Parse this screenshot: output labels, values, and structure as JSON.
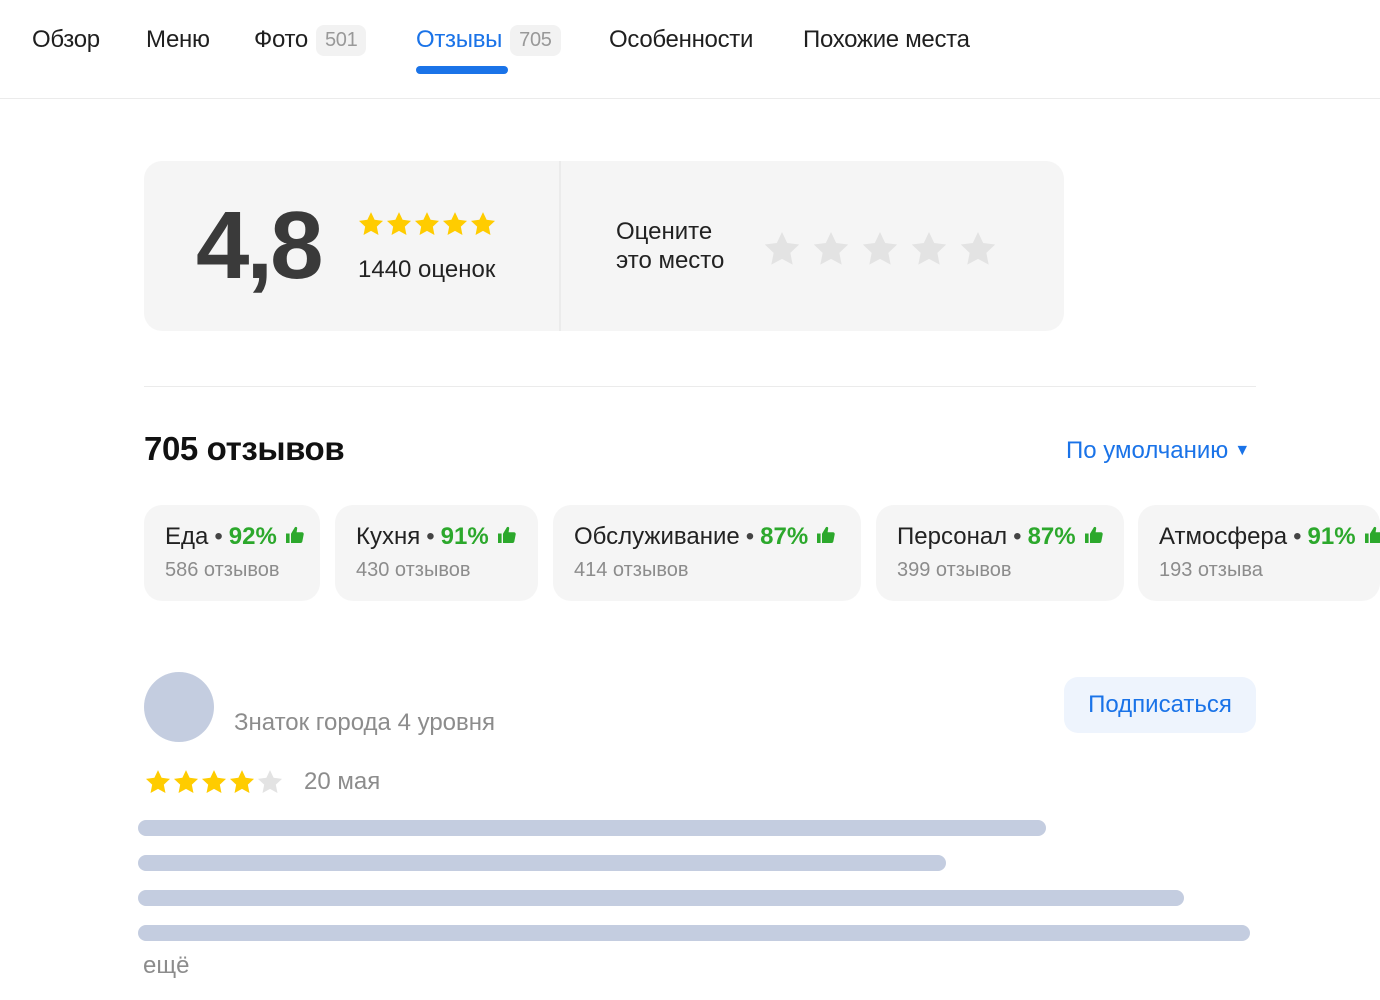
{
  "tabs": [
    {
      "label": "Обзор",
      "count": null
    },
    {
      "label": "Меню",
      "count": null
    },
    {
      "label": "Фото",
      "count": "501"
    },
    {
      "label": "Отзывы",
      "count": "705"
    },
    {
      "label": "Особенности",
      "count": null
    },
    {
      "label": "Похожие места",
      "count": null
    }
  ],
  "active_tab": "Отзывы",
  "rating": {
    "score": "4,8",
    "stars_filled": 5,
    "count_label": "1440 оценок",
    "rate_prompt_line1": "Оцените",
    "rate_prompt_line2": "это место"
  },
  "reviews": {
    "title": "705 отзывов",
    "sort_label": "По умолчанию",
    "aspects": [
      {
        "name": "Еда",
        "percent": "92%",
        "count": "586 отзывов"
      },
      {
        "name": "Кухня",
        "percent": "91%",
        "count": "430 отзывов"
      },
      {
        "name": "Обслуживание",
        "percent": "87%",
        "count": "414 отзывов"
      },
      {
        "name": "Персонал",
        "percent": "87%",
        "count": "399 отзывов"
      },
      {
        "name": "Атмосфера",
        "percent": "91%",
        "count": "193 отзыва"
      }
    ],
    "first_review": {
      "author_level": "Знаток города 4 уровня",
      "subscribe_label": "Подписаться",
      "stars_filled": 4,
      "date": "20 мая",
      "more_label": "ещё"
    }
  },
  "colors": {
    "accent": "#1a73e8",
    "star_gold": "#ffcc00",
    "star_empty": "#e3e3e3",
    "positive": "#2ca82c",
    "placeholder": "#c4cde0"
  },
  "icons": {
    "rating_star": "star-icon",
    "aspect_thumb": "thumbs-up-icon",
    "sort_caret": "caret-down-icon"
  }
}
